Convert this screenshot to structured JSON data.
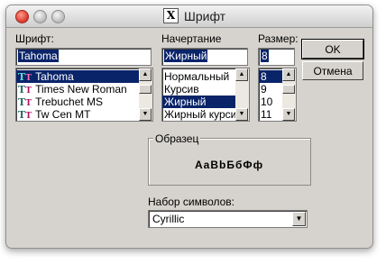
{
  "window": {
    "title": "Шрифт",
    "app_icon_letter": "X"
  },
  "font": {
    "label": "Шрифт:",
    "value": "Tahoma",
    "items": [
      {
        "label": "Tahoma",
        "selected": true
      },
      {
        "label": "Times New Roman",
        "selected": false
      },
      {
        "label": "Trebuchet MS",
        "selected": false
      },
      {
        "label": "Tw Cen MT",
        "selected": false
      }
    ],
    "icon": "truetype-icon"
  },
  "style": {
    "label": "Начертание",
    "value": "Жирный",
    "items": [
      {
        "label": "Нормальный",
        "selected": false
      },
      {
        "label": "Курсив",
        "selected": false
      },
      {
        "label": "Жирный",
        "selected": true
      },
      {
        "label": "Жирный курсив",
        "selected": false
      }
    ]
  },
  "size": {
    "label": "Размер:",
    "value": "8",
    "items": [
      {
        "label": "8",
        "selected": true
      },
      {
        "label": "9",
        "selected": false
      },
      {
        "label": "10",
        "selected": false
      },
      {
        "label": "11",
        "selected": false
      }
    ]
  },
  "buttons": {
    "ok": "OK",
    "cancel": "Отмена"
  },
  "sample": {
    "label": "Образец",
    "text": "AaBbБбФф"
  },
  "charset": {
    "label": "Набор символов:",
    "value": "Cyrillic"
  }
}
